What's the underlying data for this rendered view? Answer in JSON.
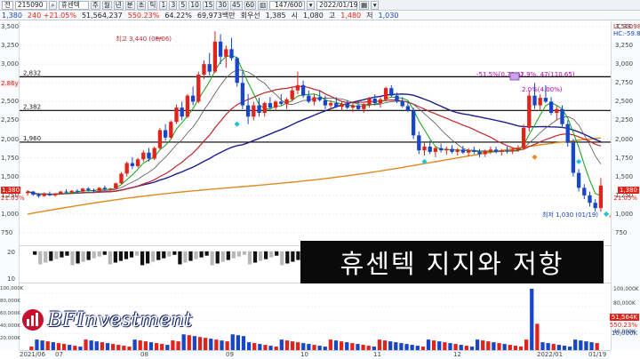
{
  "toolbar": {
    "category": "전",
    "code": "215090",
    "stock_name": "휴센텍",
    "periods": [
      "주",
      "월",
      "년",
      "분",
      "초",
      "틱"
    ],
    "minute_options": [
      "1",
      "3",
      "5",
      "10",
      "15",
      "30",
      "45",
      "60"
    ],
    "count": "147/600",
    "date": "2022/01/19"
  },
  "quote": {
    "price": "1,380",
    "change": "240 +21.05%",
    "volume": "51,564,237",
    "volume_ratio": "550.23%",
    "rate": "64.22%",
    "trade_amount": "69,973백만",
    "turnover_label": "회우선",
    "prev_label": "1,385",
    "open_label": "시",
    "open": "1,080",
    "high_label": "고",
    "high": "1,480",
    "low_label": "저",
    "low": "1,030"
  },
  "price_axis": {
    "ticks": [
      "3,500",
      "3,250",
      "3,000",
      "2,750",
      "2,500",
      "2,250",
      "2,000",
      "1,750",
      "1,500",
      "1,250",
      "1,000",
      "750"
    ],
    "right_ticks": [
      "3,500",
      "3,250",
      "3,000",
      "2,750",
      "2,500",
      "2,250",
      "2,000",
      "1,750",
      "1,500",
      "1,250",
      "1,000",
      "750"
    ],
    "lc": "LC:33.98",
    "hc": "HC:-59.88",
    "right_price_tag": "1,380",
    "right_change_tag": "21.05%",
    "left_price_tag": "1,380",
    "left_change_tag": "21.05%",
    "left_side_tag": "2.86y"
  },
  "annotations": {
    "high": "최고 3,440 (08/06)",
    "low": "최저 1,030 (01/19)",
    "fib1": "-51.5%(0.75%)",
    "fib2": "42.9%, 47(110.65)",
    "fib3": "2.0%(4.00%)"
  },
  "hlines": [
    {
      "label": "2,832",
      "value": 2832
    },
    {
      "label": "2,382",
      "value": 2382
    },
    {
      "label": "1,960",
      "value": 1960
    }
  ],
  "vol_axis": {
    "ticks": [
      "100,000K",
      "80,000K",
      "60,000K",
      "40,000K",
      "20,000K"
    ],
    "right_ticks": [
      "100,000K",
      "80,000K",
      "60,000K",
      "40,000K"
    ],
    "right_vol_tag": "51,564K",
    "right_ratio_tag": "550.23%",
    "right_small_tag": "10,000K"
  },
  "mini_axis": {
    "ticks": [
      "20",
      "10"
    ]
  },
  "dates": [
    "2021/06",
    "07",
    "08",
    "09",
    "10",
    "11",
    "12",
    "2022/01",
    "01/19"
  ],
  "caption": "휴센텍 지지와 저항",
  "logo_text": "BFInvestment",
  "colors": {
    "up": "#e0241b",
    "down": "#1846c8",
    "ma5": "#14a314",
    "ma20": "#c0262c",
    "ma60": "#1b1f8a",
    "ma120": "#e08a1e",
    "hline": "#000000"
  },
  "chart_data": {
    "type": "candlestick",
    "ylim": [
      750,
      3500
    ],
    "note": "Daily candles approximated from the screenshot",
    "candles": [
      [
        1280,
        1320,
        1250,
        1300
      ],
      [
        1300,
        1310,
        1240,
        1260
      ],
      [
        1260,
        1280,
        1220,
        1240
      ],
      [
        1240,
        1290,
        1230,
        1270
      ],
      [
        1270,
        1300,
        1240,
        1250
      ],
      [
        1250,
        1280,
        1230,
        1275
      ],
      [
        1275,
        1310,
        1260,
        1300
      ],
      [
        1300,
        1330,
        1280,
        1290
      ],
      [
        1290,
        1320,
        1270,
        1310
      ],
      [
        1310,
        1330,
        1290,
        1300
      ],
      [
        1300,
        1350,
        1290,
        1340
      ],
      [
        1340,
        1360,
        1300,
        1320
      ],
      [
        1320,
        1340,
        1290,
        1310
      ],
      [
        1310,
        1360,
        1300,
        1350
      ],
      [
        1350,
        1380,
        1320,
        1330
      ],
      [
        1330,
        1350,
        1300,
        1340
      ],
      [
        1340,
        1420,
        1330,
        1410
      ],
      [
        1410,
        1560,
        1400,
        1540
      ],
      [
        1540,
        1700,
        1500,
        1680
      ],
      [
        1680,
        1760,
        1600,
        1640
      ],
      [
        1640,
        1750,
        1620,
        1730
      ],
      [
        1730,
        1850,
        1700,
        1820
      ],
      [
        1820,
        1880,
        1700,
        1740
      ],
      [
        1740,
        1900,
        1720,
        1880
      ],
      [
        1880,
        2150,
        1860,
        2120
      ],
      [
        2120,
        2200,
        1980,
        2020
      ],
      [
        2020,
        2250,
        2000,
        2230
      ],
      [
        2230,
        2460,
        2200,
        2420
      ],
      [
        2420,
        2500,
        2250,
        2300
      ],
      [
        2300,
        2600,
        2280,
        2580
      ],
      [
        2580,
        2700,
        2450,
        2500
      ],
      [
        2500,
        2900,
        2480,
        2860
      ],
      [
        2860,
        3050,
        2800,
        3000
      ],
      [
        3000,
        3150,
        2850,
        2900
      ],
      [
        2900,
        3440,
        2880,
        3300
      ],
      [
        3300,
        3400,
        3000,
        3100
      ],
      [
        3100,
        3250,
        2950,
        3200
      ],
      [
        3200,
        3350,
        3050,
        3080
      ],
      [
        3080,
        3100,
        2700,
        2750
      ],
      [
        2750,
        2900,
        2400,
        2450
      ],
      [
        2450,
        2600,
        2200,
        2300
      ],
      [
        2300,
        2500,
        2250,
        2450
      ],
      [
        2450,
        2550,
        2300,
        2350
      ],
      [
        2350,
        2500,
        2300,
        2480
      ],
      [
        2480,
        2560,
        2400,
        2420
      ],
      [
        2420,
        2520,
        2380,
        2500
      ],
      [
        2500,
        2600,
        2450,
        2470
      ],
      [
        2470,
        2550,
        2400,
        2530
      ],
      [
        2530,
        2700,
        2500,
        2650
      ],
      [
        2650,
        2900,
        2600,
        2720
      ],
      [
        2720,
        2780,
        2550,
        2580
      ],
      [
        2580,
        2650,
        2480,
        2500
      ],
      [
        2500,
        2600,
        2450,
        2560
      ],
      [
        2560,
        2650,
        2500,
        2520
      ],
      [
        2520,
        2580,
        2400,
        2450
      ],
      [
        2450,
        2520,
        2380,
        2480
      ],
      [
        2480,
        2560,
        2420,
        2430
      ],
      [
        2430,
        2500,
        2380,
        2470
      ],
      [
        2470,
        2520,
        2400,
        2420
      ],
      [
        2420,
        2480,
        2360,
        2450
      ],
      [
        2450,
        2500,
        2380,
        2400
      ],
      [
        2400,
        2480,
        2350,
        2460
      ],
      [
        2460,
        2560,
        2420,
        2540
      ],
      [
        2540,
        2600,
        2450,
        2480
      ],
      [
        2480,
        2560,
        2420,
        2530
      ],
      [
        2530,
        2700,
        2500,
        2680
      ],
      [
        2680,
        2720,
        2560,
        2580
      ],
      [
        2580,
        2620,
        2480,
        2500
      ],
      [
        2500,
        2560,
        2420,
        2440
      ],
      [
        2440,
        2500,
        2360,
        2380
      ],
      [
        2380,
        2420,
        2000,
        2050
      ],
      [
        2050,
        2100,
        1800,
        1850
      ],
      [
        1850,
        1950,
        1780,
        1900
      ],
      [
        1900,
        1980,
        1800,
        1830
      ],
      [
        1830,
        1900,
        1760,
        1880
      ],
      [
        1880,
        1940,
        1820,
        1850
      ],
      [
        1850,
        1900,
        1790,
        1870
      ],
      [
        1870,
        1920,
        1810,
        1830
      ],
      [
        1830,
        1880,
        1780,
        1860
      ],
      [
        1860,
        1910,
        1800,
        1820
      ],
      [
        1820,
        1880,
        1770,
        1850
      ],
      [
        1850,
        1900,
        1800,
        1830
      ],
      [
        1830,
        1870,
        1760,
        1800
      ],
      [
        1800,
        1860,
        1760,
        1840
      ],
      [
        1840,
        1900,
        1800,
        1860
      ],
      [
        1860,
        1900,
        1810,
        1830
      ],
      [
        1830,
        1870,
        1780,
        1850
      ],
      [
        1850,
        1900,
        1810,
        1840
      ],
      [
        1840,
        1880,
        1800,
        1860
      ],
      [
        1860,
        1920,
        1830,
        1880
      ],
      [
        1880,
        2200,
        1860,
        2150
      ],
      [
        2150,
        2650,
        2100,
        2580
      ],
      [
        2580,
        2750,
        2400,
        2450
      ],
      [
        2450,
        2600,
        2380,
        2550
      ],
      [
        2550,
        2720,
        2480,
        2500
      ],
      [
        2500,
        2560,
        2320,
        2350
      ],
      [
        2350,
        2450,
        2250,
        2400
      ],
      [
        2400,
        2450,
        2150,
        2200
      ],
      [
        2200,
        2250,
        1900,
        1950
      ],
      [
        1950,
        2000,
        1500,
        1550
      ],
      [
        1550,
        1600,
        1300,
        1350
      ],
      [
        1350,
        1400,
        1200,
        1250
      ],
      [
        1250,
        1300,
        1100,
        1150
      ],
      [
        1150,
        1200,
        1030,
        1080
      ],
      [
        1080,
        1480,
        1030,
        1380
      ]
    ]
  }
}
